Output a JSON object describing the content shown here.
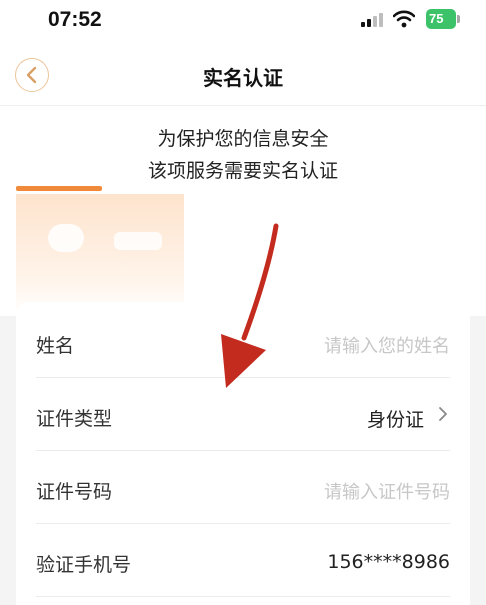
{
  "status_bar": {
    "time": "07:52",
    "battery": "75"
  },
  "nav": {
    "title": "实名认证",
    "back_icon": "chevron-left-icon"
  },
  "notice": {
    "line1": "为保护您的信息安全",
    "line2": "该项服务需要实名认证"
  },
  "form": {
    "name": {
      "label": "姓名",
      "placeholder": "请输入您的姓名"
    },
    "id_type": {
      "label": "证件类型",
      "value": "身份证"
    },
    "id_number": {
      "label": "证件号码",
      "placeholder": "请输入证件号码"
    },
    "phone": {
      "label": "验证手机号",
      "value": "156****8986"
    }
  },
  "colors": {
    "accent": "#f08a3a",
    "annotation_arrow": "#c42b1f",
    "battery": "#3cc36a"
  }
}
